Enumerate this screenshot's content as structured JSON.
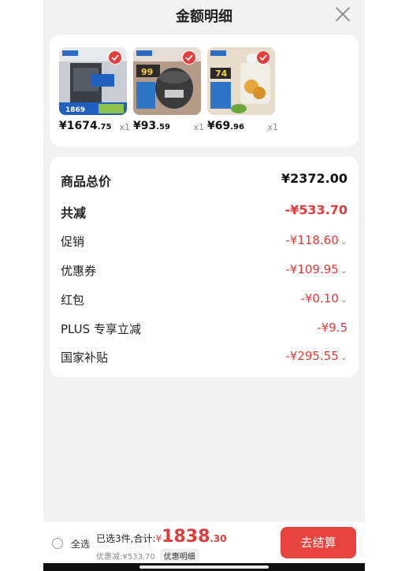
{
  "header": {
    "title": "金额明细",
    "close_icon": "close-icon"
  },
  "products": [
    {
      "price_int": "¥1674",
      "price_dec": ".75",
      "qty": "x1",
      "image": "range-hood-product",
      "badge_text": "1869"
    },
    {
      "price_int": "¥93",
      "price_dec": ".59",
      "qty": "x1",
      "image": "rice-cooker-product",
      "badge_text": "99"
    },
    {
      "price_int": "¥69",
      "price_dec": ".96",
      "qty": "x1",
      "image": "food-chopper-product",
      "badge_text": "74"
    }
  ],
  "details": {
    "total": {
      "label": "商品总价",
      "value": "¥2372.00"
    },
    "reduce": {
      "label": "共减",
      "value": "-¥533.70"
    },
    "items": [
      {
        "label": "促销",
        "value": "-¥118.60",
        "expand": true
      },
      {
        "label": "优惠券",
        "value": "-¥109.95",
        "expand": true
      },
      {
        "label": "红包",
        "value": "-¥0.10",
        "expand": true
      },
      {
        "label": "PLUS 专享立减",
        "value": "-¥9.5",
        "expand": false
      },
      {
        "label": "国家补贴",
        "value": "-¥295.55",
        "expand": true
      }
    ]
  },
  "bottom_bar": {
    "select_all": "全选",
    "selected_summary": "已选3件,合计:",
    "currency": "¥",
    "total_int": "1838",
    "total_dec": ".30",
    "discount_text": "优惠减:¥533.70",
    "detail_button": "优惠明细",
    "checkout_button": "去结算"
  },
  "colors": {
    "accent": "#e8443f",
    "price_red": "#e23b3b",
    "sheet_bg": "#f2f2f2"
  }
}
